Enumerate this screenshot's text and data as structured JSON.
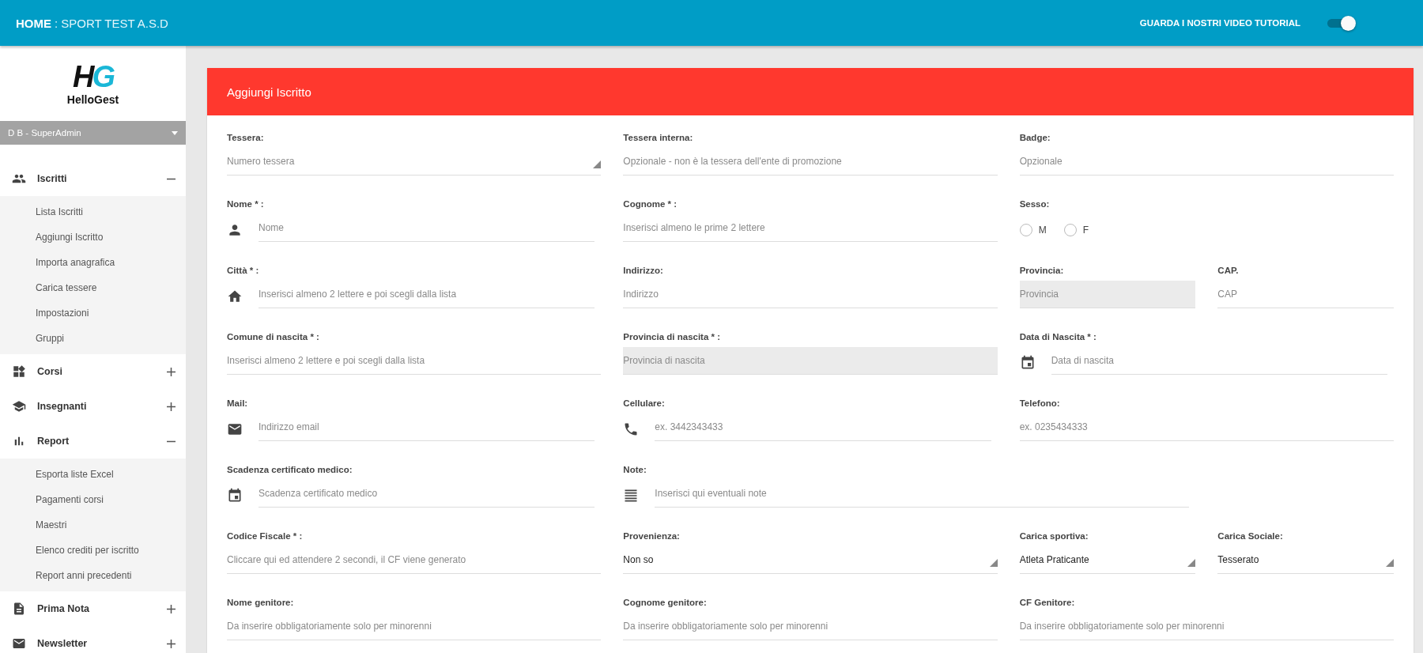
{
  "topbar": {
    "title": "HOME",
    "subtitle": ": SPORT TEST A.S.D",
    "tutorial": {
      "label": "GUARDA I NOSTRI VIDEO TUTORIAL",
      "on": true
    }
  },
  "sidebar": {
    "logo": {
      "mark_left": "H",
      "mark_right": "G",
      "name": "HelloGest"
    },
    "user": "D B - SuperAdmin",
    "items": [
      {
        "label": "Iscritti",
        "expanded": true,
        "children": [
          {
            "label": "Lista Iscritti"
          },
          {
            "label": "Aggiungi Iscritto"
          },
          {
            "label": "Importa anagrafica"
          },
          {
            "label": "Carica tessere"
          },
          {
            "label": "Impostazioni"
          },
          {
            "label": "Gruppi"
          }
        ]
      },
      {
        "label": "Corsi",
        "expanded": false
      },
      {
        "label": "Insegnanti",
        "expanded": false
      },
      {
        "label": "Report",
        "expanded": true,
        "children": [
          {
            "label": "Esporta liste Excel"
          },
          {
            "label": "Pagamenti corsi"
          },
          {
            "label": "Maestri"
          },
          {
            "label": "Elenco crediti per iscritto"
          },
          {
            "label": "Report anni precedenti"
          }
        ]
      },
      {
        "label": "Prima Nota",
        "expanded": false
      },
      {
        "label": "Newsletter",
        "expanded": false
      }
    ]
  },
  "form": {
    "title": "Aggiungi Iscritto",
    "rows": [
      {
        "cells": [
          {
            "kind": "select",
            "label": "Tessera:",
            "placeholder": "Numero tessera"
          },
          {
            "kind": "text",
            "label": "Tessera interna:",
            "placeholder": "Opzionale - non è la tessera dell'ente di promozione"
          },
          {
            "kind": "text",
            "label": "Badge:",
            "placeholder": "Opzionale"
          }
        ]
      },
      {
        "cells": [
          {
            "kind": "text",
            "label": "Nome * :",
            "placeholder": "Nome"
          },
          {
            "kind": "text",
            "label": "Cognome * :",
            "placeholder": "Inserisci almeno le prime 2 lettere"
          },
          {
            "kind": "radio",
            "label": "Sesso:",
            "options": [
              {
                "label": "M",
                "selected": false
              },
              {
                "label": "F",
                "selected": false
              }
            ]
          }
        ]
      },
      {
        "cells": [
          {
            "kind": "text",
            "label": "Città * :",
            "placeholder": "Inserisci almeno 2 lettere e poi scegli dalla lista"
          },
          {
            "kind": "text",
            "label": "Indirizzo:",
            "placeholder": "Indirizzo"
          },
          {
            "kind": "readonly",
            "label": "Provincia:",
            "placeholder": "Provincia"
          },
          {
            "kind": "text",
            "label": "CAP.",
            "placeholder": "CAP"
          }
        ]
      },
      {
        "cells": [
          {
            "kind": "text",
            "label": "Comune di nascita * :",
            "placeholder": "Inserisci almeno 2 lettere e poi scegli dalla lista"
          },
          {
            "kind": "readonly",
            "label": "Provincia di nascita * :",
            "placeholder": "Provincia di nascita"
          },
          {
            "kind": "text",
            "label": "Data di Nascita * :",
            "placeholder": "Data di nascita"
          }
        ]
      },
      {
        "cells": [
          {
            "kind": "text",
            "label": "Mail:",
            "placeholder": "Indirizzo email"
          },
          {
            "kind": "text",
            "label": "Cellulare:",
            "placeholder": "ex. 3442343433"
          },
          {
            "kind": "text",
            "label": "Telefono:",
            "placeholder": "ex. 0235434333"
          }
        ]
      },
      {
        "cells": [
          {
            "kind": "text",
            "label": "Scadenza certificato medico:",
            "placeholder": "Scadenza certificato medico"
          },
          {
            "kind": "text",
            "label": "Note:",
            "placeholder": "Inserisci qui eventuali note"
          }
        ]
      },
      {
        "cells": [
          {
            "kind": "text",
            "label": "Codice Fiscale * :",
            "placeholder": "Cliccare qui ed attendere 2 secondi, il CF viene generato"
          },
          {
            "kind": "select",
            "label": "Provenienza:",
            "value": "Non so"
          },
          {
            "kind": "select",
            "label": "Carica sportiva:",
            "value": "Atleta Praticante"
          },
          {
            "kind": "select",
            "label": "Carica Sociale:",
            "value": "Tesserato"
          }
        ]
      },
      {
        "cells": [
          {
            "kind": "text",
            "label": "Nome genitore:",
            "placeholder": "Da inserire obbligatoriamente solo per minorenni"
          },
          {
            "kind": "text",
            "label": "Cognome genitore:",
            "placeholder": "Da inserire obbligatoriamente solo per minorenni"
          },
          {
            "kind": "text",
            "label": "CF Genitore:",
            "placeholder": "Da inserire obbligatoriamente solo per minorenni"
          }
        ]
      }
    ]
  }
}
